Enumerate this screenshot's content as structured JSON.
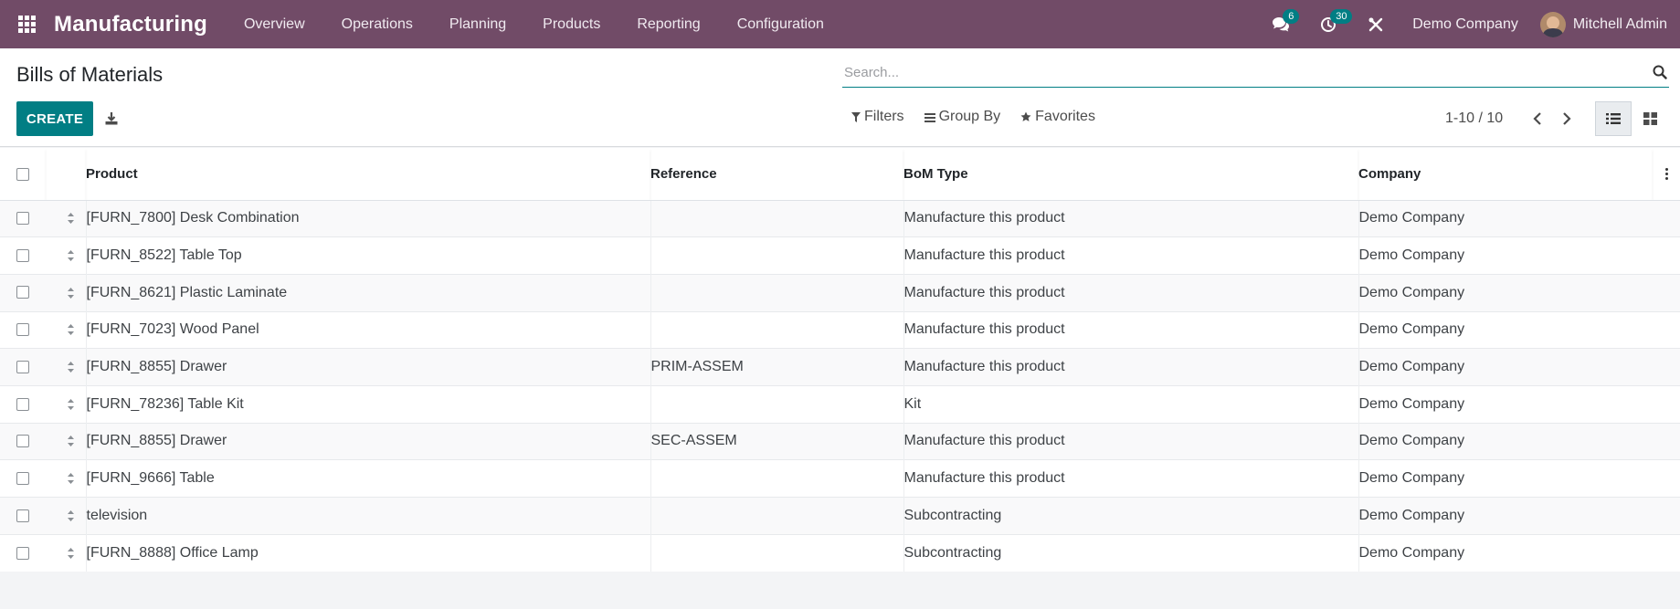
{
  "navbar": {
    "app_title": "Manufacturing",
    "menu": [
      "Overview",
      "Operations",
      "Planning",
      "Products",
      "Reporting",
      "Configuration"
    ],
    "messages_count": "6",
    "activities_count": "30",
    "company": "Demo Company",
    "user_name": "Mitchell Admin",
    "icons": [
      "apps-grid-icon",
      "chat-icon",
      "clock-icon",
      "tools-icon"
    ],
    "accent_color": "#714b67"
  },
  "control_panel": {
    "title": "Bills of Materials",
    "create_label": "CREATE",
    "search_placeholder": "Search...",
    "filters_label": "Filters",
    "group_by_label": "Group By",
    "favorites_label": "Favorites",
    "pager_value": "1-10 / 10",
    "primary_color": "#017e84"
  },
  "table": {
    "columns": {
      "product": "Product",
      "reference": "Reference",
      "bom_type": "BoM Type",
      "company": "Company"
    },
    "rows": [
      {
        "product": "[FURN_7800] Desk Combination",
        "reference": "",
        "bom_type": "Manufacture this product",
        "company": "Demo Company"
      },
      {
        "product": "[FURN_8522] Table Top",
        "reference": "",
        "bom_type": "Manufacture this product",
        "company": "Demo Company"
      },
      {
        "product": "[FURN_8621] Plastic Laminate",
        "reference": "",
        "bom_type": "Manufacture this product",
        "company": "Demo Company"
      },
      {
        "product": "[FURN_7023] Wood Panel",
        "reference": "",
        "bom_type": "Manufacture this product",
        "company": "Demo Company"
      },
      {
        "product": "[FURN_8855] Drawer",
        "reference": "PRIM-ASSEM",
        "bom_type": "Manufacture this product",
        "company": "Demo Company"
      },
      {
        "product": "[FURN_78236] Table Kit",
        "reference": "",
        "bom_type": "Kit",
        "company": "Demo Company"
      },
      {
        "product": "[FURN_8855] Drawer",
        "reference": "SEC-ASSEM",
        "bom_type": "Manufacture this product",
        "company": "Demo Company"
      },
      {
        "product": "[FURN_9666] Table",
        "reference": "",
        "bom_type": "Manufacture this product",
        "company": "Demo Company"
      },
      {
        "product": "television",
        "reference": "",
        "bom_type": "Subcontracting",
        "company": "Demo Company"
      },
      {
        "product": "[FURN_8888] Office Lamp",
        "reference": "",
        "bom_type": "Subcontracting",
        "company": "Demo Company"
      }
    ]
  }
}
